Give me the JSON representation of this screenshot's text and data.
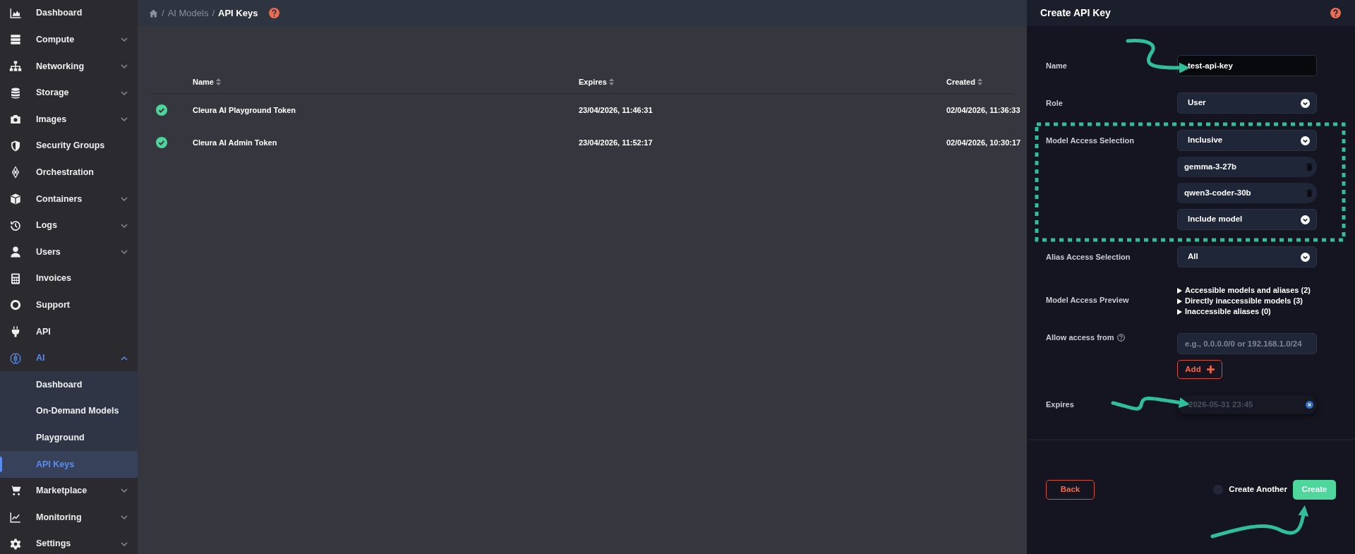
{
  "sidebar": {
    "items": [
      {
        "kind": "link",
        "label": "Dashboard",
        "selected": false
      },
      {
        "kind": "group",
        "label": "Compute",
        "expanded": false,
        "selected": false
      },
      {
        "kind": "group",
        "label": "Networking",
        "expanded": false,
        "selected": false
      },
      {
        "kind": "group",
        "label": "Storage",
        "expanded": false,
        "selected": false
      },
      {
        "kind": "group",
        "label": "Images",
        "expanded": false,
        "selected": false
      },
      {
        "kind": "link",
        "label": "Security Groups",
        "selected": false
      },
      {
        "kind": "link",
        "label": "Orchestration",
        "selected": false
      },
      {
        "kind": "group",
        "label": "Containers",
        "expanded": false,
        "selected": false
      },
      {
        "kind": "group",
        "label": "Logs",
        "expanded": false,
        "selected": false
      },
      {
        "kind": "group",
        "label": "Users",
        "expanded": false,
        "selected": false
      },
      {
        "kind": "link",
        "label": "Invoices",
        "selected": false
      },
      {
        "kind": "link",
        "label": "Support",
        "selected": false
      },
      {
        "kind": "link",
        "label": "API",
        "selected": false
      },
      {
        "kind": "group",
        "label": "AI",
        "expanded": true,
        "selected": true,
        "children": [
          {
            "label": "Dashboard",
            "selected": false
          },
          {
            "label": "On-Demand Models",
            "selected": false
          },
          {
            "label": "Playground",
            "selected": false
          },
          {
            "label": "API Keys",
            "selected": true
          }
        ]
      },
      {
        "kind": "group",
        "label": "Marketplace",
        "expanded": false,
        "selected": false
      },
      {
        "kind": "group",
        "label": "Monitoring",
        "expanded": false,
        "selected": false
      },
      {
        "kind": "group",
        "label": "Settings",
        "expanded": false,
        "selected": false
      }
    ]
  },
  "breadcrumb": {
    "separator": "/",
    "items": [
      "AI Models",
      "API Keys"
    ]
  },
  "table": {
    "columns": [
      "Name",
      "Expires",
      "Created"
    ],
    "rows": [
      {
        "active": true,
        "name": "Cleura AI Playground Token",
        "expires": "23/04/2026, 11:46:31",
        "created": "02/04/2026, 11:36:33"
      },
      {
        "active": true,
        "name": "Cleura AI Admin Token",
        "expires": "23/04/2026, 11:52:17",
        "created": "02/04/2026, 10:30:17"
      }
    ]
  },
  "form": {
    "title": "Create API Key",
    "fields": [
      {
        "kind": "text",
        "label": "Name",
        "value": "test-api-key"
      },
      {
        "kind": "select",
        "label": "Role",
        "value": "User"
      },
      {
        "kind": "model_access",
        "label": "Model Access Selection",
        "mode": "Inclusive",
        "models": [
          "gemma-3-27b",
          "qwen3-coder-30b"
        ],
        "add_label": "Include model"
      },
      {
        "kind": "select",
        "label": "Alias Access Selection",
        "value": "All"
      },
      {
        "kind": "preview",
        "label": "Model Access Preview",
        "items": [
          "Accessible models and aliases (2)",
          "Directly inaccessible models (3)",
          "Inaccessible aliases (0)"
        ]
      },
      {
        "kind": "ip",
        "label": "Allow access from",
        "placeholder": "e.g., 0.0.0.0/0 or 192.168.1.0/24",
        "button": "Add"
      },
      {
        "kind": "date",
        "label": "Expires",
        "value": "2026-05-31 23:45"
      }
    ],
    "back": "Back",
    "create_another": {
      "label": "Create Another",
      "on": false
    },
    "submit": "Create"
  }
}
